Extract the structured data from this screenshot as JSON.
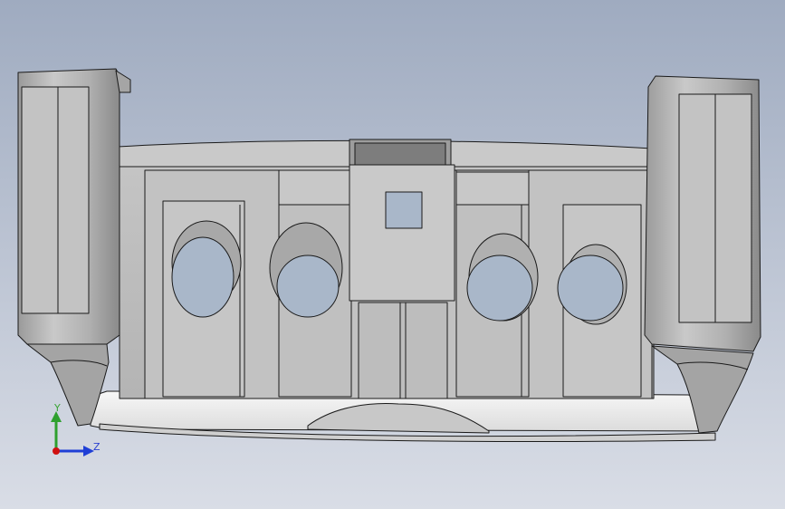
{
  "viewport": {
    "background_top": "#9fabc0",
    "background_bottom": "#d9dde6"
  },
  "triad": {
    "y_label": "Y",
    "z_label": "Z",
    "y_color": "#2ea02e",
    "z_color": "#1f3fd6",
    "origin_color": "#d01010"
  },
  "model": {
    "name_icon": "cad-part-icon",
    "edge_color": "#1a1a1a",
    "face_light": "#d6d6d6",
    "face_mid": "#b8b8b8",
    "face_dark": "#8f8f8f",
    "hole_color": "#a9b7c9",
    "bottom_rim": "#f2f2f2"
  }
}
